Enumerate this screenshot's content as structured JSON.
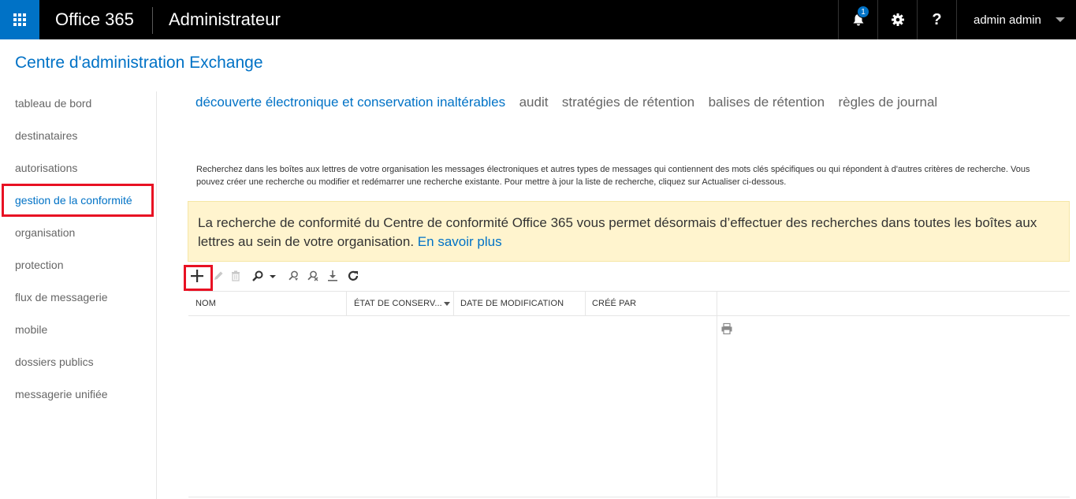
{
  "header": {
    "brand": "Office 365",
    "app_title": "Administrateur",
    "notification_count": "1",
    "help_label": "?",
    "user_name": "admin admin",
    "icons": [
      "app-launcher-icon",
      "bell-icon",
      "gear-icon",
      "help-icon",
      "chevron-down-icon"
    ]
  },
  "page_title": "Centre d'administration Exchange",
  "nav": {
    "items": [
      {
        "label": "tableau de bord"
      },
      {
        "label": "destinataires"
      },
      {
        "label": "autorisations"
      },
      {
        "label": "gestion de la conformité"
      },
      {
        "label": "organisation"
      },
      {
        "label": "protection"
      },
      {
        "label": "flux de messagerie"
      },
      {
        "label": "mobile"
      },
      {
        "label": "dossiers publics"
      },
      {
        "label": "messagerie unifiée"
      }
    ],
    "active_index": 3
  },
  "tabs": [
    {
      "label": "découverte électronique et conservation inaltérables"
    },
    {
      "label": "audit"
    },
    {
      "label": "stratégies de rétention"
    },
    {
      "label": "balises de rétention"
    },
    {
      "label": "règles de journal"
    }
  ],
  "description": "Recherchez dans les boîtes aux lettres de votre organisation les messages électroniques et autres types de messages qui contiennent des mots clés spécifiques ou qui répondent à d'autres critères de recherche. Vous pouvez créer une recherche ou modifier et redémarrer une recherche existante. Pour mettre à jour la liste de recherche, cliquez sur Actualiser ci-dessous.",
  "banner": {
    "text": "La recherche de conformité du Centre de conformité Office 365 vous permet désormais d’effectuer des recherches dans toutes les boîtes aux lettres au sein de votre organisation.",
    "link": "En savoir plus"
  },
  "toolbar": {
    "icons": [
      "add-icon",
      "edit-icon",
      "delete-icon",
      "search-icon",
      "search-dropdown-icon",
      "search-mailbox-icon",
      "remove-search-icon",
      "export-icon",
      "refresh-icon"
    ]
  },
  "table": {
    "columns": [
      "NOM",
      "ÉTAT DE CONSERV...",
      "DATE DE MODIFICATION",
      "CRÉÉ PAR"
    ],
    "rows": []
  },
  "colors": {
    "accent": "#0072c6",
    "topbar": "#000000",
    "banner_bg": "#fff4ce",
    "highlight": "#e81123"
  }
}
